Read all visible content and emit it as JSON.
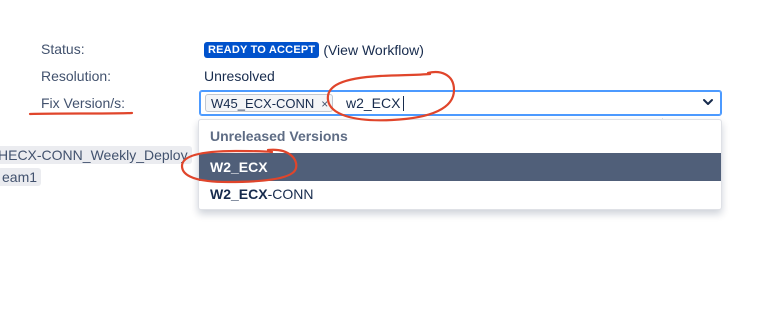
{
  "fields": {
    "status_label": "Status:",
    "status_badge": "READY TO ACCEPT",
    "status_link": "(View Workflow)",
    "resolution_label": "Resolution:",
    "resolution_value": "Unresolved",
    "fix_version_label": "Fix Version/s:"
  },
  "picker": {
    "selected_chip": "W45_ECX-CONN",
    "chip_remove": "×",
    "query": "w2_ECX",
    "chevron": "chevron-down-icon"
  },
  "dropdown": {
    "group_label": "Unreleased Versions",
    "options": [
      {
        "match": "W2_ECX",
        "rest": "",
        "active": true
      },
      {
        "match": "W2_ECX",
        "rest": "-CONN",
        "active": false
      }
    ]
  },
  "background": {
    "sprint_chip_1": "HECX-CONN_Weekly_Deploy",
    "sprint_chip_2": "eam1"
  },
  "colors": {
    "status_badge_bg": "#0052cc",
    "focus_border": "#4c9aff",
    "active_option_bg": "#505f79",
    "annotation_red": "#e0452b"
  }
}
